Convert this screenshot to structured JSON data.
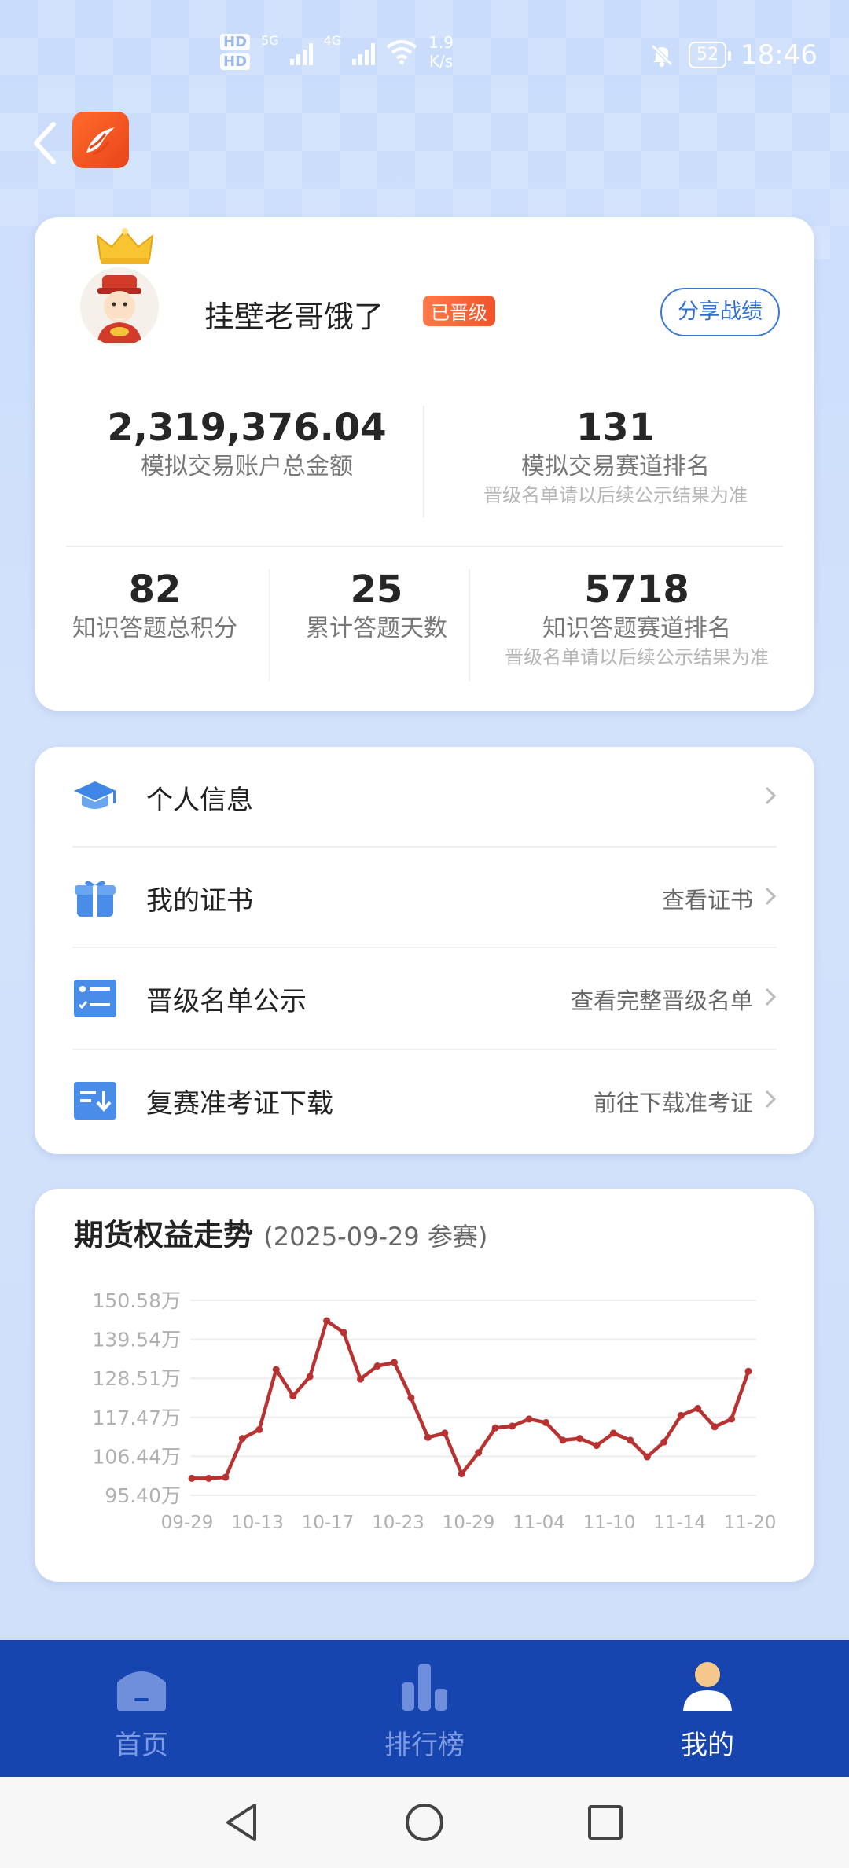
{
  "status_bar": {
    "hd_labels": [
      "HD",
      "HD"
    ],
    "network_1": "5G",
    "network_2": "4G",
    "speed_value": "1.9",
    "speed_unit": "K/s",
    "battery": "52",
    "time": "18:46"
  },
  "profile": {
    "username": "挂壁老哥饿了",
    "badge": "已晋级",
    "share_label": "分享战绩",
    "stats_top": [
      {
        "value": "2,319,376.04",
        "label": "模拟交易账户总金额",
        "note": ""
      },
      {
        "value": "131",
        "label": "模拟交易赛道排名",
        "note": "晋级名单请以后续公示结果为准"
      }
    ],
    "stats_bottom": [
      {
        "value": "82",
        "label": "知识答题总积分",
        "note": ""
      },
      {
        "value": "25",
        "label": "累计答题天数",
        "note": ""
      },
      {
        "value": "5718",
        "label": "知识答题赛道排名",
        "note": "晋级名单请以后续公示结果为准"
      }
    ]
  },
  "menu": [
    {
      "icon": "graduation-cap-icon",
      "title": "个人信息",
      "sub": ""
    },
    {
      "icon": "gift-box-icon",
      "title": "我的证书",
      "sub": "查看证书"
    },
    {
      "icon": "list-icon",
      "title": "晋级名单公示",
      "sub": "查看完整晋级名单"
    },
    {
      "icon": "download-doc-icon",
      "title": "复赛准考证下载",
      "sub": "前往下载准考证"
    }
  ],
  "chart_title": "期货权益走势",
  "chart_subtitle": "(2025-09-29 参赛)",
  "chart_data": {
    "type": "line",
    "title": "期货权益走势",
    "subtitle": "(2025-09-29 参赛)",
    "y_tick_labels": [
      "150.58万",
      "139.54万",
      "128.51万",
      "117.47万",
      "106.44万",
      "95.40万"
    ],
    "y_ticks": [
      150.58,
      139.54,
      128.51,
      117.47,
      106.44,
      95.4
    ],
    "ylim": [
      95.4,
      150.58
    ],
    "x_tick_labels": [
      "09-29",
      "10-13",
      "10-17",
      "10-23",
      "10-29",
      "11-04",
      "11-10",
      "11-14",
      "11-20"
    ],
    "grid": true,
    "color": "#b83232",
    "series": [
      {
        "values": [
          100.2,
          100.2,
          100.5,
          111.5,
          114.0,
          131.0,
          123.5,
          129.0,
          144.8,
          141.5,
          128.3,
          132.0,
          133.0,
          123.0,
          111.8,
          113.0,
          101.5,
          107.5,
          114.5,
          115.0,
          117.0,
          116.0,
          111.0,
          111.5,
          109.5,
          113.0,
          111.0,
          106.3,
          110.5,
          118.0,
          120.0,
          114.8,
          117.0,
          130.5
        ]
      }
    ]
  },
  "tabs": [
    {
      "icon": "home-icon",
      "label": "首页",
      "active": false
    },
    {
      "icon": "ranking-icon",
      "label": "排行榜",
      "active": false
    },
    {
      "icon": "profile-icon",
      "label": "我的",
      "active": true
    }
  ]
}
